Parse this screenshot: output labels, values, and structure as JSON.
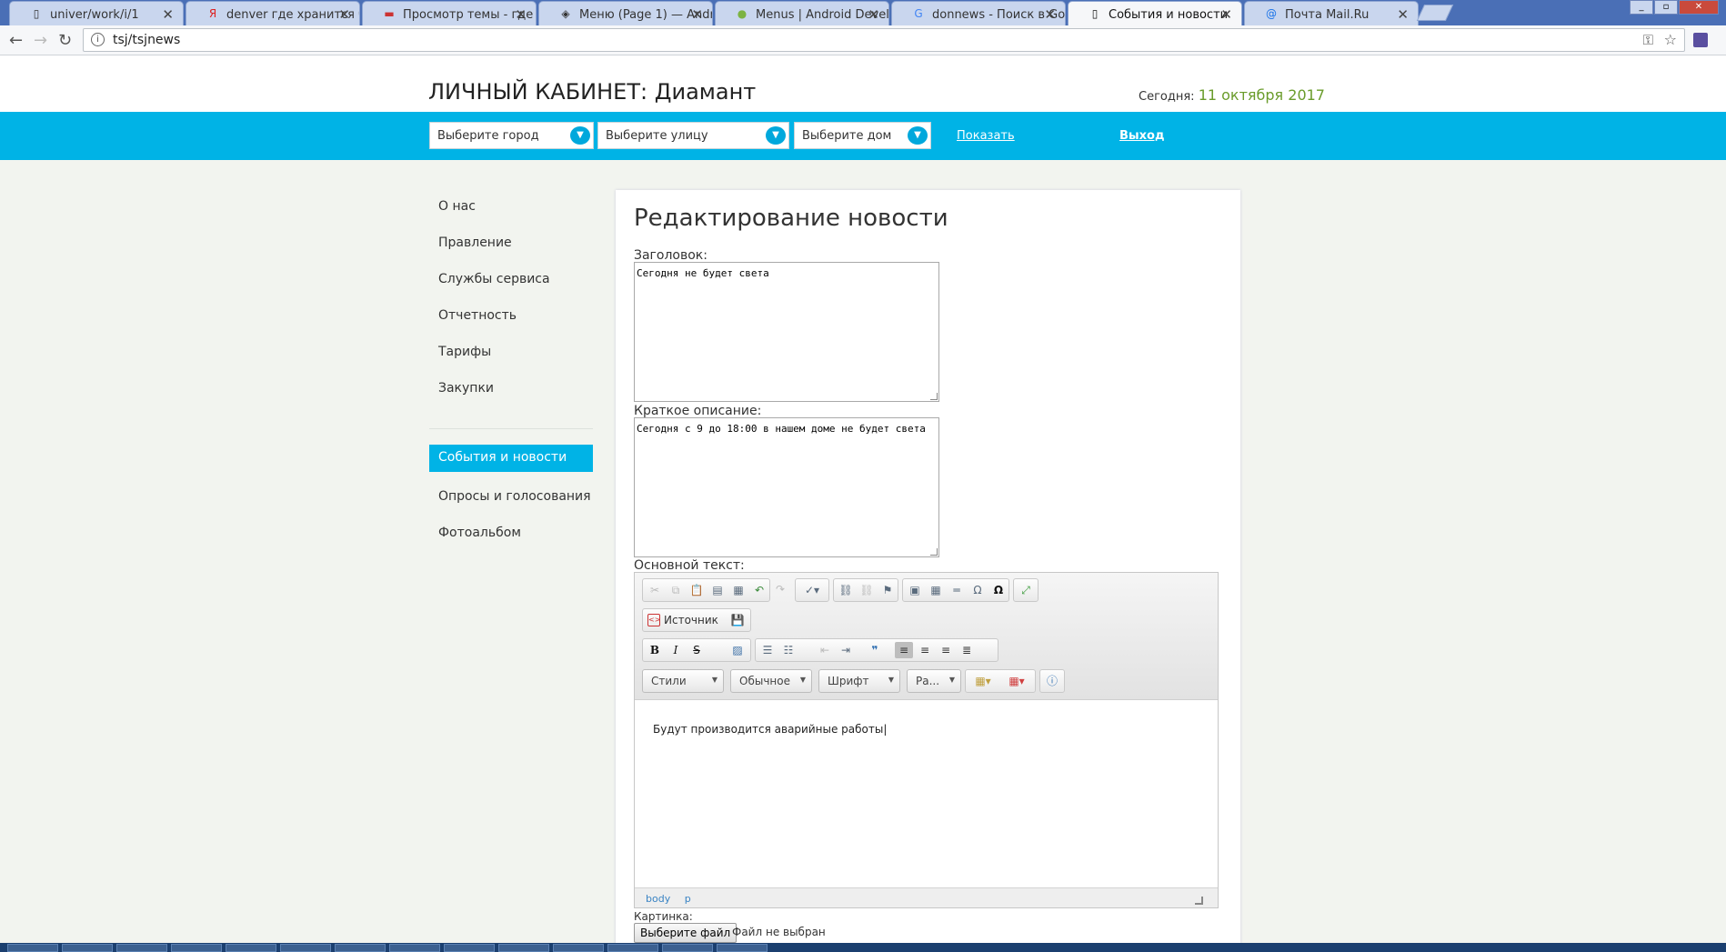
{
  "browser": {
    "tabs": [
      {
        "title": "univer/work/i/1",
        "icon": "page-icon",
        "active": false
      },
      {
        "title": "denver где хранится бд",
        "icon": "yandex-icon",
        "active": false
      },
      {
        "title": "Просмотр темы - где хр",
        "icon": "forum-icon",
        "active": false
      },
      {
        "title": "Меню (Page 1) — Andro",
        "icon": "diamond-icon",
        "active": false
      },
      {
        "title": "Menus | Android Develop",
        "icon": "android-icon",
        "active": false
      },
      {
        "title": "donnews - Поиск в Goo",
        "icon": "google-icon",
        "active": false
      },
      {
        "title": "События и новости",
        "icon": "page-icon",
        "active": true
      },
      {
        "title": "Почта Mail.Ru",
        "icon": "mail-icon",
        "active": false
      }
    ],
    "url": "tsj/tsjnews"
  },
  "header": {
    "title": "ЛИЧНЫЙ КАБИНЕТ: Диамант",
    "today_label": "Сегодня:",
    "today_value": "11 октября 2017"
  },
  "filters": {
    "city_placeholder": "Выберите город",
    "street_placeholder": "Выберите улицу",
    "house_placeholder": "Выберите дом",
    "show_label": "Показать",
    "logout_label": "Выход"
  },
  "sidebar": {
    "group1": [
      "О нас",
      "Правление",
      "Службы сервиса",
      "Отчетность",
      "Тарифы",
      "Закупки"
    ],
    "group2": [
      "События и новости",
      "Опросы и голосования",
      "Фотоальбом"
    ],
    "active": "События и новости"
  },
  "form": {
    "heading": "Редактирование новости",
    "title_label": "Заголовок:",
    "title_value": "Сегодня не будет света",
    "summary_label": "Краткое описание:",
    "summary_value": "Сегодня с 9 до 18:00 в нашем доме не будет света",
    "body_label": "Основной текст:",
    "source_label": "Источник",
    "styles_label": "Стили",
    "format_label": "Обычное",
    "font_label": "Шрифт",
    "size_label": "Ра...",
    "body_text": "Будут  производится аварийные работы",
    "path": [
      "body",
      "p"
    ],
    "image_label": "Картинка:",
    "file_button": "Выберите файл",
    "file_status": "Файл не выбран"
  },
  "colors": {
    "accent": "#00b3e6",
    "date": "#6a9c2b"
  }
}
